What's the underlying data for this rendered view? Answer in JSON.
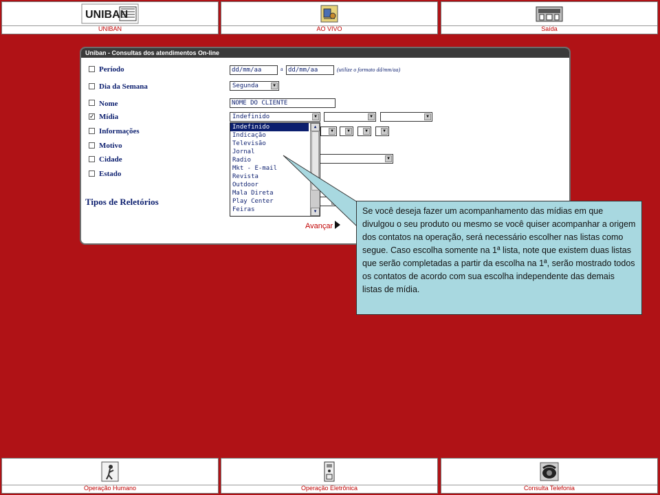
{
  "top_nav": [
    {
      "label": "UNIBAN",
      "icon": "uniban-logo"
    },
    {
      "label": "AO VIVO",
      "icon": "live-icon"
    },
    {
      "label": "Saída",
      "icon": "exit-building-icon"
    }
  ],
  "bottom_nav": [
    {
      "label": "Operação Humano",
      "icon": "human-operator-icon"
    },
    {
      "label": "Operação Eletrônica",
      "icon": "electronic-device-icon"
    },
    {
      "label": "Consulta Telefonia",
      "icon": "telephone-icon"
    }
  ],
  "logo_text": "UNIBAN",
  "panel": {
    "title": "Uniban - Consultas dos atendimentos On-line",
    "fields": {
      "periodo": {
        "label": "Período",
        "checked": false,
        "from": "dd/mm/aa",
        "sep": "a",
        "to": "dd/mm/aa",
        "hint": "(utilize o formato dd/mm/aa)"
      },
      "dia_semana": {
        "label": "Dia da Semana",
        "checked": false,
        "value": "Segunda"
      },
      "nome": {
        "label": "Nome",
        "checked": false,
        "value": "NOME DO CLIENTE"
      },
      "midia": {
        "label": "Mídia",
        "checked": true,
        "checkmark": "✓",
        "value": "Indefinido"
      },
      "informacoes": {
        "label": "Informações",
        "checked": false
      },
      "motivo": {
        "label": "Motivo",
        "checked": false
      },
      "cidade": {
        "label": "Cidade",
        "checked": false
      },
      "estado": {
        "label": "Estado",
        "checked": false
      }
    },
    "midia_options": [
      "Indefinido",
      "Indicação",
      "Televisão",
      "Jornal",
      "Radio",
      "Mkt - E-mail",
      "Revista",
      "Outdoor",
      "Mala Direta",
      "Play Center",
      "Feiras"
    ],
    "tipos_title": "Tipos de Reletórios",
    "avancar": "Avançar"
  },
  "callout": {
    "text": "Se você deseja fazer um acompanhamento das mídias em que divulgou o seu produto ou mesmo se você quiser acompanhar a origem dos contatos na operação, será necessário escolher nas listas como segue. Caso escolha somente na 1ª lista, note que existem duas listas que serão completadas a partir da escolha na 1ª, serão mostrado todos os contatos de acordo com sua escolha independente das demais listas de mídia."
  },
  "colors": {
    "background": "#b01216",
    "label_blue": "#0b1e6e",
    "nav_red": "#c00000",
    "callout_bg": "#a8d8e0"
  }
}
